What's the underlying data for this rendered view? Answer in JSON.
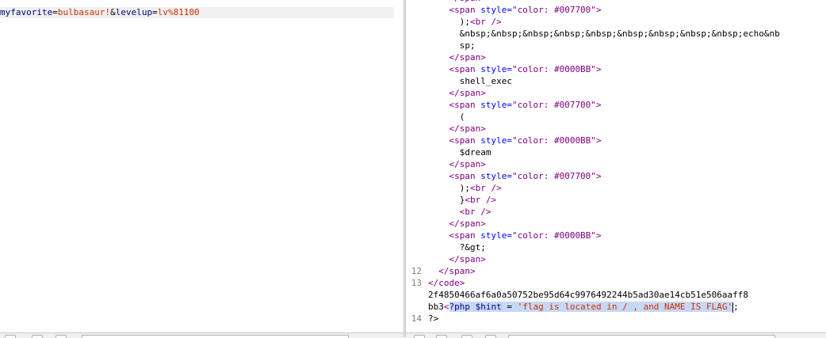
{
  "request": {
    "tokens": [
      {
        "type": "key",
        "text": "myfavorite"
      },
      {
        "type": "op",
        "text": "="
      },
      {
        "type": "val",
        "text": "bulbasaur!"
      },
      {
        "type": "op",
        "text": "&"
      },
      {
        "type": "key",
        "text": "levelup"
      },
      {
        "type": "op",
        "text": "="
      },
      {
        "type": "val",
        "text": "lv%81100"
      }
    ]
  },
  "response": {
    "lines": [
      {
        "num": "",
        "indent": 4,
        "segs": [
          {
            "c": "tag",
            "t": "</span>"
          }
        ]
      },
      {
        "num": "",
        "indent": 4,
        "segs": [
          {
            "c": "tag",
            "t": "<span "
          },
          {
            "c": "attr",
            "t": "style="
          },
          {
            "c": "str",
            "t": "\"color: #007700\""
          },
          {
            "c": "tag",
            "t": ">"
          }
        ]
      },
      {
        "num": "",
        "indent": 6,
        "segs": [
          {
            "c": "plain",
            "t": ");"
          },
          {
            "c": "tag",
            "t": "<br />"
          }
        ]
      },
      {
        "num": "",
        "indent": 6,
        "segs": [
          {
            "c": "plain",
            "t": "&nbsp;&nbsp;&nbsp;&nbsp;&nbsp;&nbsp;&nbsp;&nbsp;&nbsp;echo&nb"
          }
        ]
      },
      {
        "num": "",
        "indent": 6,
        "segs": [
          {
            "c": "plain",
            "t": "sp;"
          }
        ]
      },
      {
        "num": "",
        "indent": 4,
        "segs": [
          {
            "c": "tag",
            "t": "</span>"
          }
        ]
      },
      {
        "num": "",
        "indent": 4,
        "segs": [
          {
            "c": "tag",
            "t": "<span "
          },
          {
            "c": "attr",
            "t": "style="
          },
          {
            "c": "str",
            "t": "\"color: #0000BB\""
          },
          {
            "c": "tag",
            "t": ">"
          }
        ]
      },
      {
        "num": "",
        "indent": 6,
        "segs": [
          {
            "c": "plain",
            "t": "shell_exec"
          }
        ]
      },
      {
        "num": "",
        "indent": 4,
        "segs": [
          {
            "c": "tag",
            "t": "</span>"
          }
        ]
      },
      {
        "num": "",
        "indent": 4,
        "segs": [
          {
            "c": "tag",
            "t": "<span "
          },
          {
            "c": "attr",
            "t": "style="
          },
          {
            "c": "str",
            "t": "\"color: #007700\""
          },
          {
            "c": "tag",
            "t": ">"
          }
        ]
      },
      {
        "num": "",
        "indent": 6,
        "segs": [
          {
            "c": "plain",
            "t": "("
          }
        ]
      },
      {
        "num": "",
        "indent": 4,
        "segs": [
          {
            "c": "tag",
            "t": "</span>"
          }
        ]
      },
      {
        "num": "",
        "indent": 4,
        "segs": [
          {
            "c": "tag",
            "t": "<span "
          },
          {
            "c": "attr",
            "t": "style="
          },
          {
            "c": "str",
            "t": "\"color: #0000BB\""
          },
          {
            "c": "tag",
            "t": ">"
          }
        ]
      },
      {
        "num": "",
        "indent": 6,
        "segs": [
          {
            "c": "plain",
            "t": "$dream"
          }
        ]
      },
      {
        "num": "",
        "indent": 4,
        "segs": [
          {
            "c": "tag",
            "t": "</span>"
          }
        ]
      },
      {
        "num": "",
        "indent": 4,
        "segs": [
          {
            "c": "tag",
            "t": "<span "
          },
          {
            "c": "attr",
            "t": "style="
          },
          {
            "c": "str",
            "t": "\"color: #007700\""
          },
          {
            "c": "tag",
            "t": ">"
          }
        ]
      },
      {
        "num": "",
        "indent": 6,
        "segs": [
          {
            "c": "plain",
            "t": ");"
          },
          {
            "c": "tag",
            "t": "<br />"
          }
        ]
      },
      {
        "num": "",
        "indent": 6,
        "segs": [
          {
            "c": "plain",
            "t": "}"
          },
          {
            "c": "tag",
            "t": "<br />"
          }
        ]
      },
      {
        "num": "",
        "indent": 6,
        "segs": [
          {
            "c": "tag",
            "t": "<br />"
          }
        ]
      },
      {
        "num": "",
        "indent": 4,
        "segs": [
          {
            "c": "tag",
            "t": "</span>"
          }
        ]
      },
      {
        "num": "",
        "indent": 4,
        "segs": [
          {
            "c": "tag",
            "t": "<span "
          },
          {
            "c": "attr",
            "t": "style="
          },
          {
            "c": "str",
            "t": "\"color: #0000BB\""
          },
          {
            "c": "tag",
            "t": ">"
          }
        ]
      },
      {
        "num": "",
        "indent": 6,
        "segs": [
          {
            "c": "plain",
            "t": "?&gt;"
          }
        ]
      },
      {
        "num": "",
        "indent": 4,
        "segs": [
          {
            "c": "tag",
            "t": "</span>"
          }
        ]
      },
      {
        "num": "12",
        "indent": 2,
        "segs": [
          {
            "c": "tag",
            "t": "</span>"
          }
        ]
      },
      {
        "num": "13",
        "indent": 0,
        "segs": [
          {
            "c": "tag",
            "t": "</code>"
          }
        ]
      },
      {
        "num": "",
        "indent": 0,
        "segs": [
          {
            "c": "plain",
            "t": "2f4850466af6a0a50752be95d64c9976492244b5ad30ae14cb51e506aaff8"
          }
        ]
      },
      {
        "num": "",
        "indent": 0,
        "segs": [
          {
            "c": "plain",
            "t": "bb3"
          },
          {
            "c": "tag",
            "t": "<"
          },
          {
            "c": "php-kw sel",
            "t": "?php "
          },
          {
            "c": "php-var sel",
            "t": "$hint"
          },
          {
            "c": "plain sel",
            "t": " = "
          },
          {
            "c": "php-str sel",
            "t": "'flag is located in / , and NAME IS FLAG'"
          },
          {
            "c": "plain",
            "t": ";"
          }
        ],
        "caret": true
      },
      {
        "num": "14",
        "indent": 0,
        "segs": [
          {
            "c": "plain",
            "t": "?>"
          }
        ]
      }
    ]
  }
}
